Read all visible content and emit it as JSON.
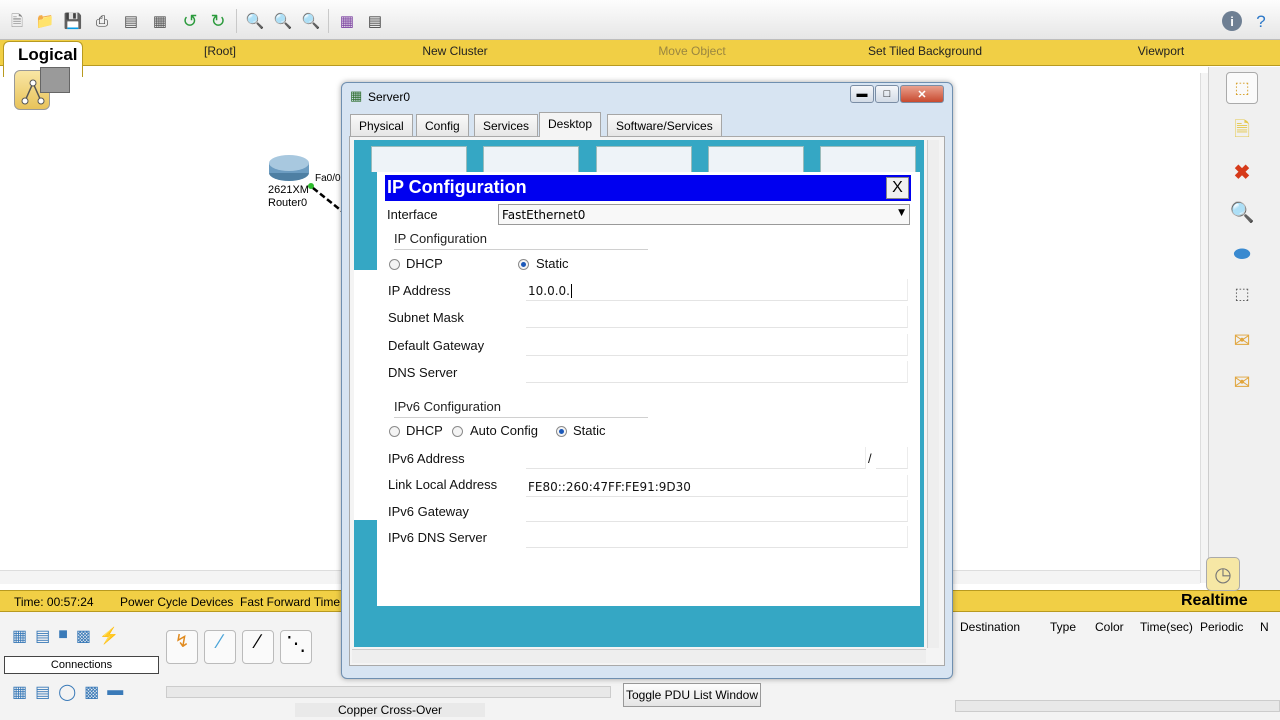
{
  "toolbar": {
    "icons": [
      "new-icon",
      "open-icon",
      "save-icon",
      "print-icon",
      "activity-wizard-icon",
      "network-info-icon",
      "undo-icon",
      "redo-icon",
      "zoom-in-icon",
      "zoom-reset-icon",
      "zoom-out-icon",
      "palette-icon",
      "custom-device-icon"
    ],
    "help_icon": "info-icon"
  },
  "logical_bar": {
    "tab_label": "Logical",
    "items": [
      "[Root]",
      "New Cluster",
      "Move Object",
      "Set Tiled Background",
      "Viewport"
    ]
  },
  "workspace": {
    "router_label_1": "2621XM",
    "router_label_2": "Router0",
    "port_label": "Fa0/0"
  },
  "status": {
    "time": "Time: 00:57:24",
    "power_cycle": "Power Cycle Devices",
    "fast_forward": "Fast Forward Time",
    "realtime": "Realtime"
  },
  "bottom": {
    "connections_label": "Connections",
    "cable_label": "Copper Cross-Over",
    "toggle_pdu": "Toggle PDU List Window",
    "pdu_columns": [
      "Destination",
      "Type",
      "Color",
      "Time(sec)",
      "Periodic",
      "N"
    ]
  },
  "dialog": {
    "title": "Server0",
    "tabs": [
      "Physical",
      "Config",
      "Services",
      "Desktop",
      "Software/Services"
    ],
    "active_tab": "Desktop"
  },
  "ipconfig": {
    "header": "IP Configuration",
    "close_label": "X",
    "interface_label": "Interface",
    "interface_value": "FastEthernet0",
    "ipv4_section": "IP Configuration",
    "dhcp_label": "DHCP",
    "static_label": "Static",
    "ip_address_label": "IP Address",
    "ip_address_value": "10.0.0.",
    "subnet_mask_label": "Subnet Mask",
    "subnet_mask_value": "",
    "default_gateway_label": "Default Gateway",
    "default_gateway_value": "",
    "dns_server_label": "DNS Server",
    "dns_server_value": "",
    "ipv6_section": "IPv6 Configuration",
    "ipv6_dhcp_label": "DHCP",
    "ipv6_auto_label": "Auto Config",
    "ipv6_static_label": "Static",
    "ipv6_address_label": "IPv6 Address",
    "ipv6_address_value": "",
    "prefix_separator": "/",
    "link_local_label": "Link Local Address",
    "link_local_value": "FE80::260:47FF:FE91:9D30",
    "ipv6_gateway_label": "IPv6 Gateway",
    "ipv6_gateway_value": "",
    "ipv6_dns_label": "IPv6 DNS Server",
    "ipv6_dns_value": ""
  },
  "colors": {
    "header_blue": "#0000f0",
    "desktop_teal": "#35a7c4",
    "bar_yellow": "#f1cf45"
  }
}
